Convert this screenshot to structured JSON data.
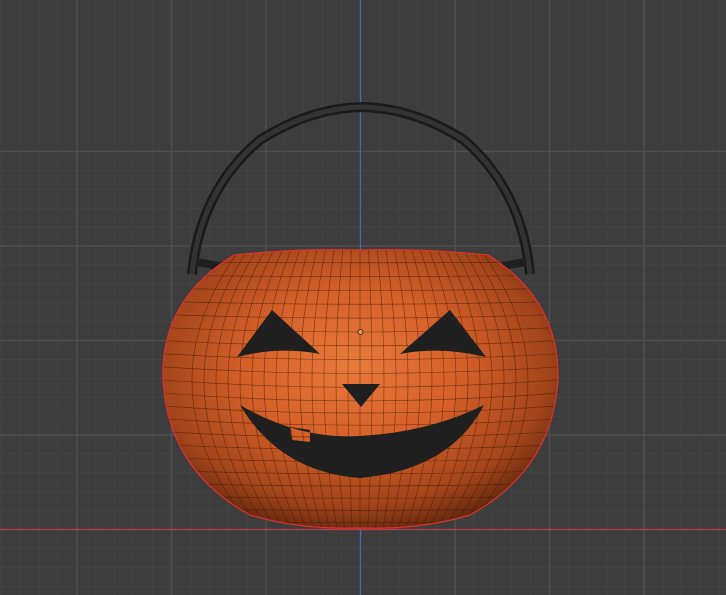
{
  "viewport": {
    "view": "front-orthographic",
    "object": "pumpkin-bucket",
    "colors": {
      "background": "#3d3d3d",
      "grid_minor": "#444444",
      "grid_major": "#4f4f4f",
      "axis_x": "#c0394a",
      "axis_z": "#3a6fb0",
      "pumpkin_light": "#e8773a",
      "pumpkin_dark": "#6a2a10",
      "face": "#1f1f1f",
      "handle": "#2b2b2b",
      "selection_outline": "#e03030"
    },
    "icons": [
      "object-origin-icon"
    ]
  }
}
